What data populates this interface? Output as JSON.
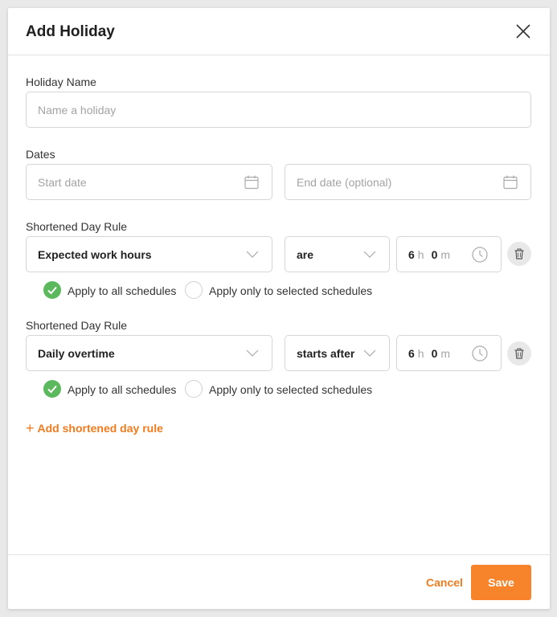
{
  "modal": {
    "title": "Add Holiday"
  },
  "holiday_name": {
    "label": "Holiday Name",
    "placeholder": "Name a holiday"
  },
  "dates": {
    "label": "Dates",
    "start_placeholder": "Start date",
    "end_placeholder": "End date (optional)"
  },
  "rules": [
    {
      "label": "Shortened Day Rule",
      "metric": "Expected work hours",
      "operator": "are",
      "hours": "6",
      "hours_unit": "h",
      "minutes": "0",
      "minutes_unit": "m",
      "apply_all_label": "Apply to all schedules",
      "apply_selected_label": "Apply only to selected schedules",
      "apply_all_selected": true
    },
    {
      "label": "Shortened Day Rule",
      "metric": "Daily overtime",
      "operator": "starts after",
      "hours": "6",
      "hours_unit": "h",
      "minutes": "0",
      "minutes_unit": "m",
      "apply_all_label": "Apply to all schedules",
      "apply_selected_label": "Apply only to selected schedules",
      "apply_all_selected": true
    }
  ],
  "add_rule_label": "Add shortened day rule",
  "footer": {
    "cancel_label": "Cancel",
    "save_label": "Save"
  },
  "colors": {
    "accent": "#f7832a",
    "link": "#f07b1e",
    "check": "#5cb85c"
  }
}
